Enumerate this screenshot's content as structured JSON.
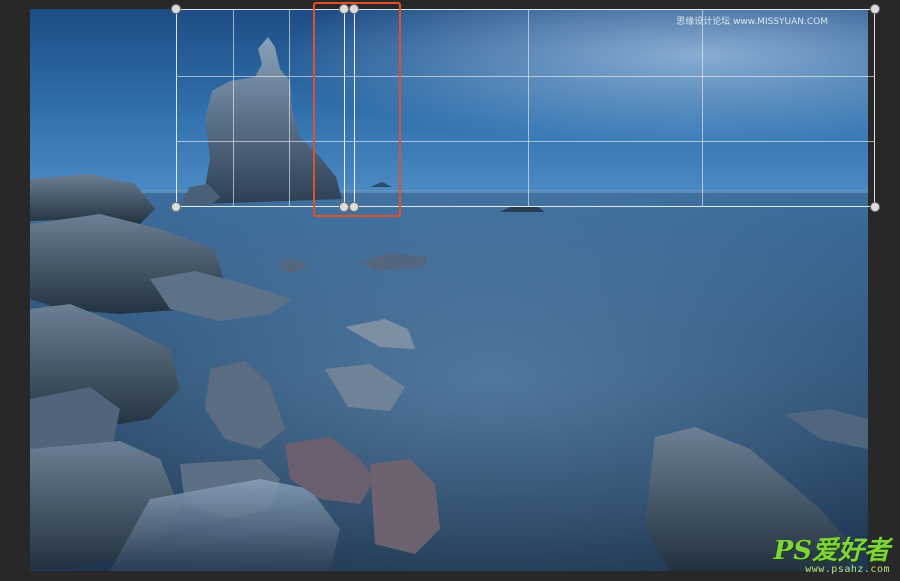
{
  "canvas": {
    "watermark_top": "思缘设计论坛 www.MISSYUAN.COM",
    "watermark_brand": "PS爱好者",
    "watermark_url": "www.psahz.com"
  },
  "colors": {
    "crop_border": "#ffffff",
    "handle": "#dcdcdc",
    "highlight": "#e0502a",
    "logo_green": "#7fd43a"
  },
  "icons": {
    "crop_handle": "circle-handle-icon"
  }
}
